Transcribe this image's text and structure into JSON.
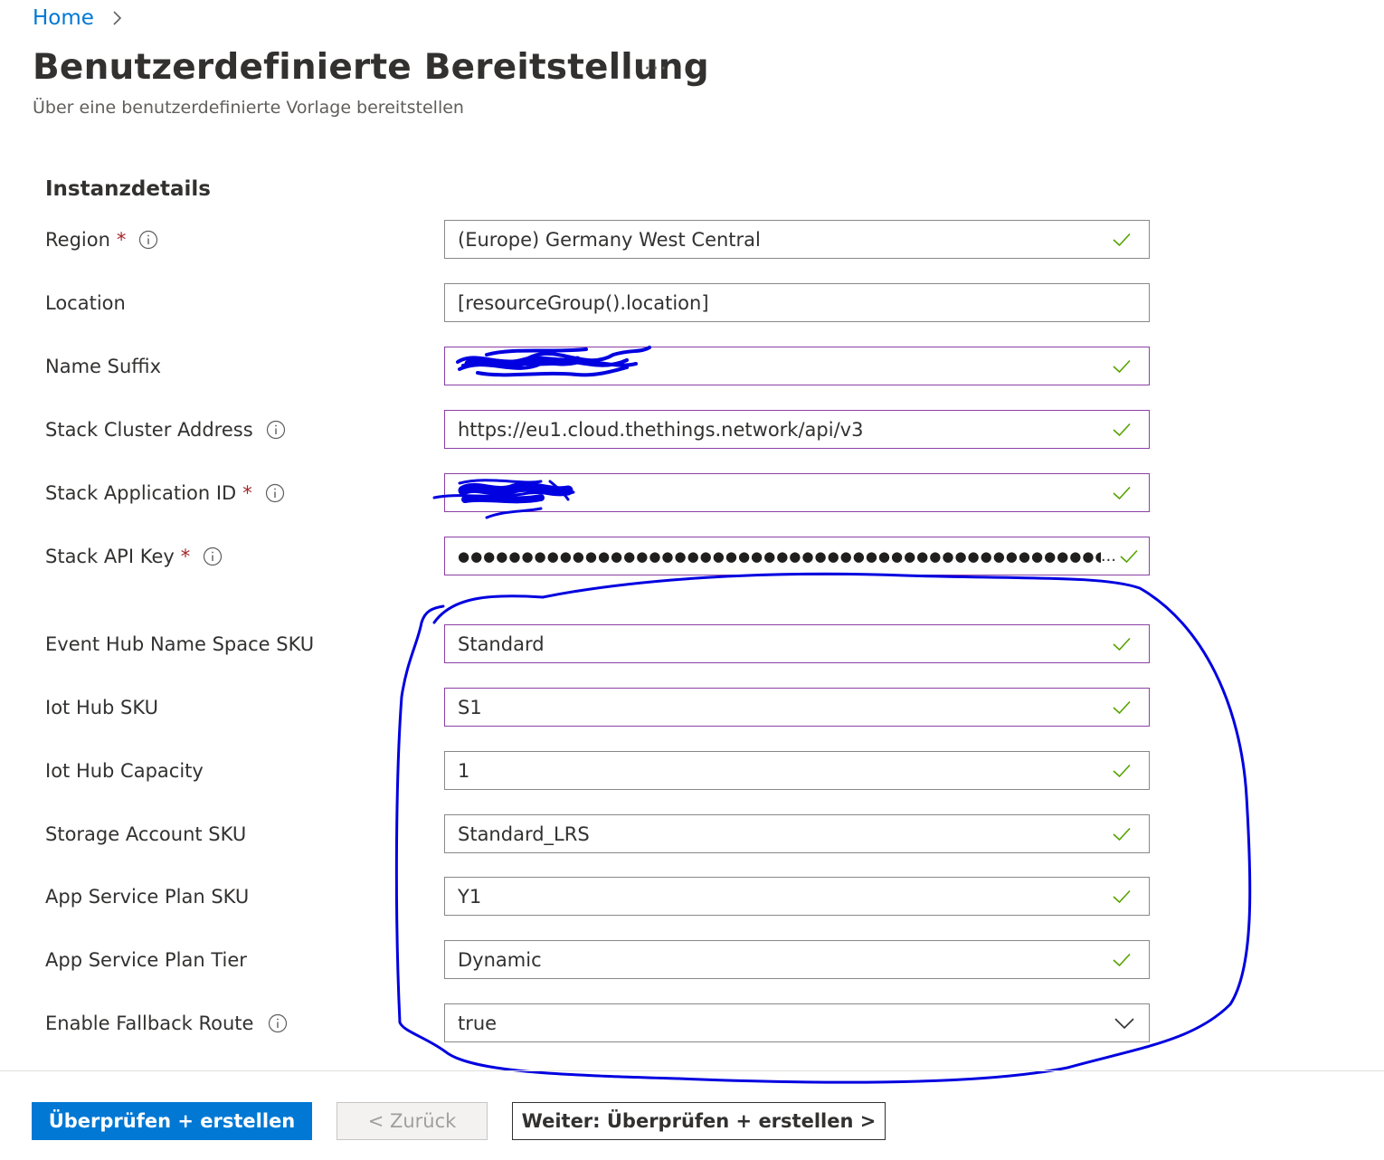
{
  "breadcrumb": {
    "home": "Home"
  },
  "page": {
    "title": "Benutzerdefinierte Bereitstellung",
    "more": "···",
    "subtitle": "Über eine benutzerdefinierte Vorlage bereitstellen"
  },
  "section": {
    "title": "Instanzdetails"
  },
  "fields": [
    {
      "label": "Region",
      "required": "*",
      "value": "(Europe) Germany West Central"
    },
    {
      "label": "Location",
      "value": "[resourceGroup().location]"
    },
    {
      "label": "Name Suffix",
      "value": ""
    },
    {
      "label": "Stack Cluster Address",
      "value": "https://eu1.cloud.thethings.network/api/v3"
    },
    {
      "label": "Stack Application ID",
      "required": "*",
      "value": ""
    },
    {
      "label": "Stack API Key",
      "required": "*",
      "value": "●●●●●●●●●●●●●●●●●●●●●●●●●●●●●●●●●●●●●●●●●●●●●●●●●●●●●●●●●●●●",
      "ellipsis": "..."
    },
    {
      "label": "Event Hub Name Space SKU",
      "value": "Standard"
    },
    {
      "label": "Iot Hub SKU",
      "value": "S1"
    },
    {
      "label": "Iot Hub Capacity",
      "value": "1"
    },
    {
      "label": "Storage Account SKU",
      "value": "Standard_LRS"
    },
    {
      "label": "App Service Plan SKU",
      "value": "Y1"
    },
    {
      "label": "App Service Plan Tier",
      "value": "Dynamic"
    },
    {
      "label": "Enable Fallback Route",
      "value": "true"
    }
  ],
  "footer": {
    "review_create": "Überprüfen + erstellen",
    "back": "< Zurück",
    "next": "Weiter: Überprüfen + erstellen >"
  },
  "colors": {
    "accent": "#0078d4",
    "valid_check": "#57a300",
    "required_star": "#a4262c",
    "focus_border": "#8c3fa8",
    "annotation_ink": "#0000e0"
  },
  "icons": [
    "chevron-right-icon",
    "more-icon",
    "info-icon",
    "checkmark-icon",
    "chevron-down-icon"
  ]
}
